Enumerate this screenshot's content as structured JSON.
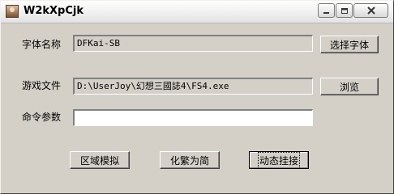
{
  "window": {
    "title": "W2kXpCjk"
  },
  "font_name": {
    "label": "字体名称",
    "value": "DFKai-SB",
    "button": "选择字体"
  },
  "game_file": {
    "label": "游戏文件",
    "value": "D:\\UserJoy\\幻想三國誌4\\FS4.exe",
    "button": "浏览"
  },
  "command_args": {
    "label": "命令参数",
    "value": ""
  },
  "actions": {
    "region_emulate": "区域模拟",
    "trad_to_simp": "化繁为简",
    "dynamic_hook": "动态挂接"
  }
}
